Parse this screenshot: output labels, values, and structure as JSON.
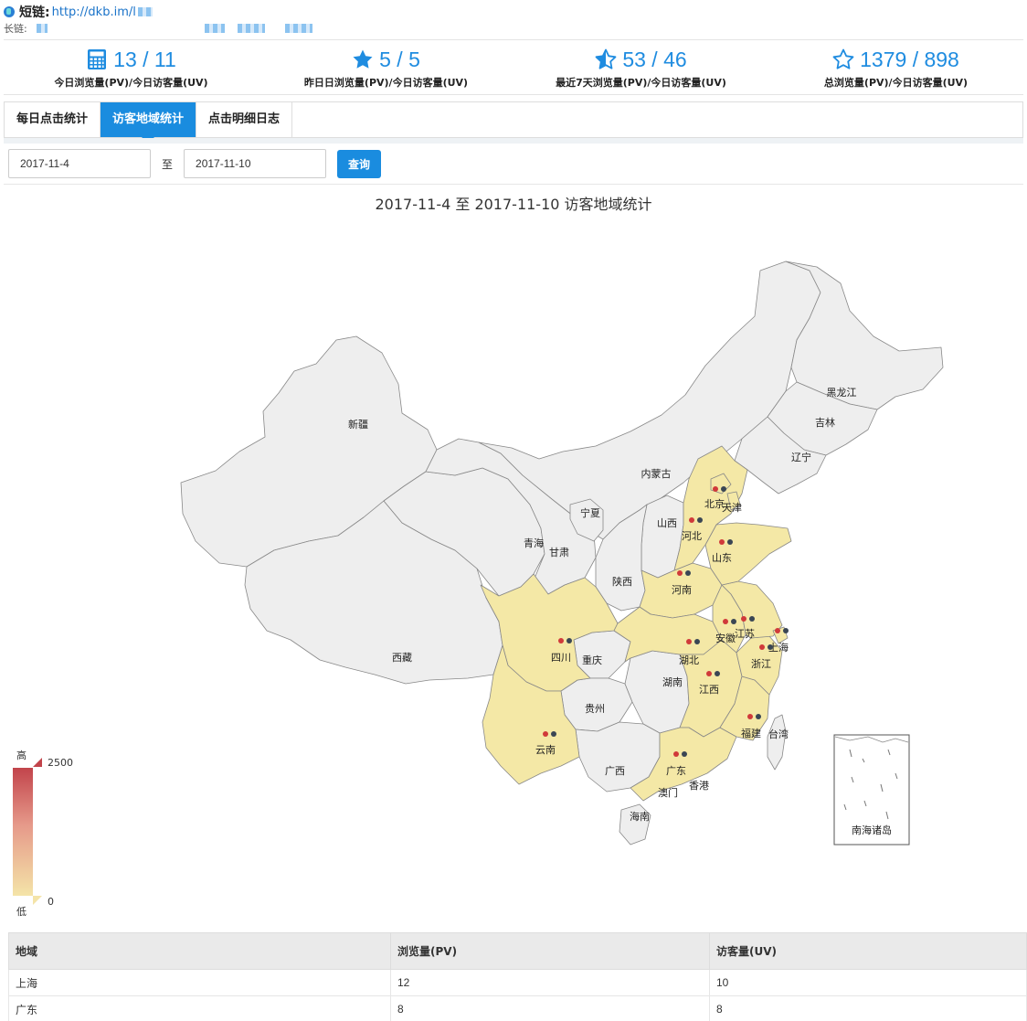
{
  "header": {
    "short_link_label": "短链:",
    "short_link_url": "http://dkb.im/l",
    "long_link_label": "长链:"
  },
  "stats": [
    {
      "icon": "calculator-icon",
      "value": "13 / 11",
      "label": "今日浏览量(PV)/今日访客量(UV)"
    },
    {
      "icon": "star-solid-icon",
      "value": "5 / 5",
      "label": "昨日日浏览量(PV)/今日访客量(UV)"
    },
    {
      "icon": "star-half-icon",
      "value": "53 / 46",
      "label": "最近7天浏览量(PV)/今日访客量(UV)"
    },
    {
      "icon": "star-outline-icon",
      "value": "1379 / 898",
      "label": "总浏览量(PV)/今日访客量(UV)"
    }
  ],
  "tabs": [
    {
      "label": "每日点击统计",
      "active": false
    },
    {
      "label": "访客地域统计",
      "active": true
    },
    {
      "label": "点击明细日志",
      "active": false
    }
  ],
  "filter": {
    "start_date": "2017-11-4",
    "to_label": "至",
    "end_date": "2017-11-10",
    "query_label": "查询"
  },
  "chart_data": {
    "type": "map",
    "title": "2017-11-4 至 2017-11-10 访客地域统计",
    "visual_map": {
      "high_label": "高",
      "low_label": "低",
      "max": 2500,
      "min": 0
    },
    "colors": {
      "highlighted": "#f4e8a6",
      "default": "#eeeeee",
      "border": "#888888",
      "pv_dot": "#d03a3a",
      "uv_dot": "#3a4654"
    },
    "highlighted_regions": [
      "北京",
      "天津",
      "河北",
      "山东",
      "河南",
      "江苏",
      "安徽",
      "上海",
      "湖北",
      "浙江",
      "江西",
      "福建",
      "广东",
      "四川",
      "云南"
    ],
    "labels": [
      "新疆",
      "西藏",
      "内蒙古",
      "黑龙江",
      "吉林",
      "辽宁",
      "北京",
      "天津",
      "河北",
      "山西",
      "宁夏",
      "青海",
      "甘肃",
      "陕西",
      "山东",
      "河南",
      "江苏",
      "安徽",
      "上海",
      "湖北",
      "重庆",
      "四川",
      "浙江",
      "湖南",
      "江西",
      "贵州",
      "云南",
      "福建",
      "台湾",
      "广西",
      "广东",
      "香港",
      "澳门",
      "海南",
      "南海诸岛"
    ]
  },
  "table": {
    "headers": [
      "地域",
      "浏览量(PV)",
      "访客量(UV)"
    ],
    "rows": [
      [
        "上海",
        "12",
        "10"
      ],
      [
        "广东",
        "8",
        "8"
      ]
    ]
  }
}
